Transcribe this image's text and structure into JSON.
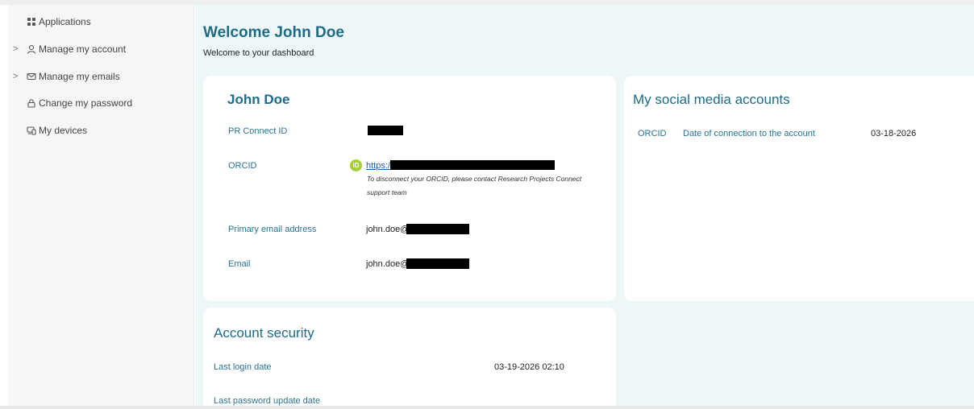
{
  "sidebar": {
    "items": [
      {
        "label": "Applications",
        "icon": "grid-icon",
        "has_chevron": false
      },
      {
        "label": "Manage my account",
        "icon": "user-icon",
        "has_chevron": true
      },
      {
        "label": "Manage my emails",
        "icon": "mail-icon",
        "has_chevron": true
      },
      {
        "label": "Change my password",
        "icon": "lock-icon",
        "has_chevron": false
      },
      {
        "label": "My devices",
        "icon": "devices-icon",
        "has_chevron": false
      }
    ]
  },
  "header": {
    "title": "Welcome John Doe",
    "subtitle": "Welcome to your dashboard"
  },
  "profile": {
    "name": "John Doe",
    "pr_connect_id_label": "PR Connect ID",
    "orcid_label": "ORCID",
    "orcid_badge": "iD",
    "orcid_link_prefix": "https:/",
    "orcid_note": "To disconnect your ORCID, please contact Research Projects Connect support team",
    "primary_email_label": "Primary email address",
    "primary_email_prefix": "john.doe@",
    "email_label": "Email",
    "email_prefix": "john.doe@"
  },
  "social": {
    "title": "My social media accounts",
    "row": {
      "provider": "ORCID",
      "label": "Date of connection to the account",
      "date": "03-18-2026"
    }
  },
  "security": {
    "title": "Account security",
    "last_login_label": "Last login date",
    "last_login_value": "03-19-2026 02:10",
    "last_password_label": "Last password update date"
  },
  "colors": {
    "accent": "#1e6b86",
    "background": "#eef7f7",
    "orcid_green": "#a6ce39"
  }
}
